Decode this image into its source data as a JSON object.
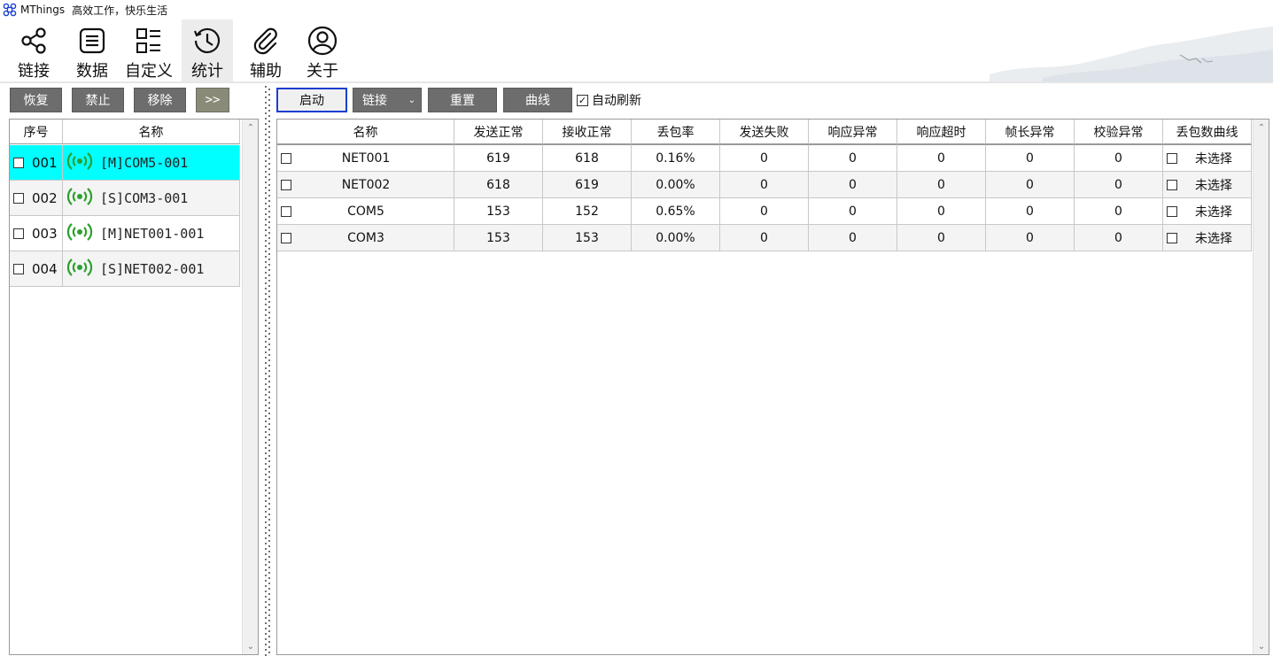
{
  "window": {
    "app_name": "MThings",
    "slogan": "高效工作，快乐生活",
    "logo_icon": "network-logo-icon"
  },
  "toolbar": {
    "items": [
      {
        "label": "链接",
        "icon": "share-nodes-icon",
        "active": false
      },
      {
        "label": "数据",
        "icon": "list-document-icon",
        "active": false
      },
      {
        "label": "自定义",
        "icon": "layout-grid-icon",
        "active": false
      },
      {
        "label": "统计",
        "icon": "history-clock-icon",
        "active": true
      },
      {
        "label": "辅助",
        "icon": "paperclip-icon",
        "active": false
      },
      {
        "label": "关于",
        "icon": "user-circle-icon",
        "active": false
      }
    ]
  },
  "left_panel": {
    "buttons": {
      "restore": "恢复",
      "disable": "禁止",
      "remove": "移除",
      "more": ">>"
    },
    "columns": {
      "index": "序号",
      "name": "名称"
    },
    "rows": [
      {
        "index": "001",
        "name": "[M]COM5-001",
        "selected": true
      },
      {
        "index": "002",
        "name": "[S]COM3-001",
        "selected": false
      },
      {
        "index": "003",
        "name": "[M]NET001-001",
        "selected": false
      },
      {
        "index": "004",
        "name": "[S]NET002-001",
        "selected": false
      }
    ],
    "row_icon": "signal-broadcast-icon",
    "icon_color": "#2ca02c",
    "selected_color": "#00ffff"
  },
  "right_panel": {
    "buttons": {
      "start": "启动",
      "link_select": "链接",
      "reset": "重置",
      "curve": "曲线"
    },
    "auto_refresh": {
      "label": "自动刷新",
      "checked": true
    },
    "columns": [
      "名称",
      "发送正常",
      "接收正常",
      "丢包率",
      "发送失败",
      "响应异常",
      "响应超时",
      "帧长异常",
      "校验异常",
      "丢包数曲线"
    ],
    "rows": [
      {
        "name": "NET001",
        "send_ok": "619",
        "recv_ok": "618",
        "loss_rate": "0.16%",
        "send_fail": "0",
        "resp_err": "0",
        "resp_timeout": "0",
        "frame_len_err": "0",
        "checksum_err": "0",
        "curve": "未选择"
      },
      {
        "name": "NET002",
        "send_ok": "618",
        "recv_ok": "619",
        "loss_rate": "0.00%",
        "send_fail": "0",
        "resp_err": "0",
        "resp_timeout": "0",
        "frame_len_err": "0",
        "checksum_err": "0",
        "curve": "未选择"
      },
      {
        "name": "COM5",
        "send_ok": "153",
        "recv_ok": "152",
        "loss_rate": "0.65%",
        "send_fail": "0",
        "resp_err": "0",
        "resp_timeout": "0",
        "frame_len_err": "0",
        "checksum_err": "0",
        "curve": "未选择"
      },
      {
        "name": "COM3",
        "send_ok": "153",
        "recv_ok": "153",
        "loss_rate": "0.00%",
        "send_fail": "0",
        "resp_err": "0",
        "resp_timeout": "0",
        "frame_len_err": "0",
        "checksum_err": "0",
        "curve": "未选择"
      }
    ],
    "accent_color": "#1a3fd0"
  }
}
